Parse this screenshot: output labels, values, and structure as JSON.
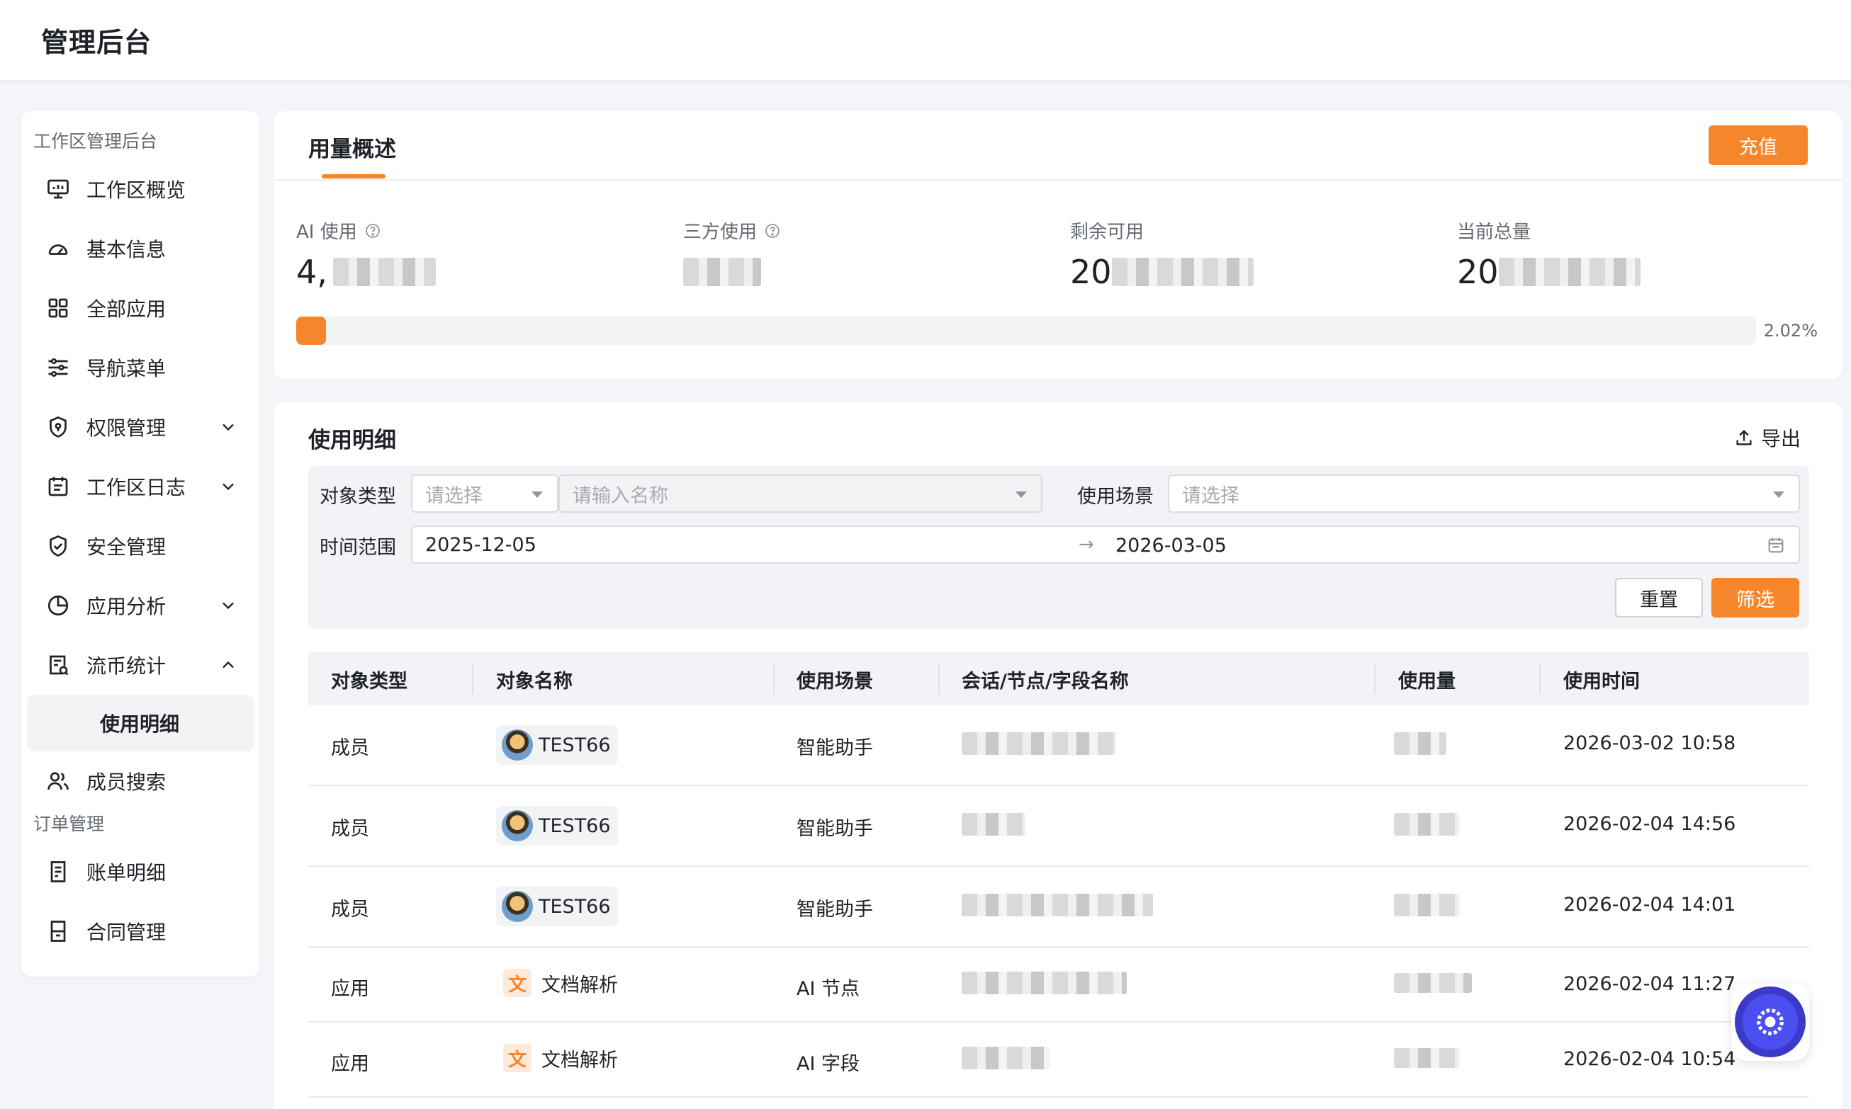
{
  "app": {
    "title": "管理后台"
  },
  "sidebar": {
    "group1": "工作区管理后台",
    "items": [
      {
        "label": "工作区概览",
        "icon": "monitor-icon"
      },
      {
        "label": "基本信息",
        "icon": "dashboard-icon"
      },
      {
        "label": "全部应用",
        "icon": "grid-icon"
      },
      {
        "label": "导航菜单",
        "icon": "sliders-icon"
      },
      {
        "label": "权限管理",
        "icon": "shield-lock-icon",
        "expandable": true
      },
      {
        "label": "工作区日志",
        "icon": "calendar-icon",
        "expandable": true
      },
      {
        "label": "安全管理",
        "icon": "shield-check-icon"
      },
      {
        "label": "应用分析",
        "icon": "pie-chart-icon",
        "expandable": true
      },
      {
        "label": "流币统计",
        "icon": "report-icon",
        "expanded": true
      }
    ],
    "sub_item": "使用明细",
    "item_member_search": "成员搜索",
    "group2": "订单管理",
    "items2": [
      {
        "label": "账单明细",
        "icon": "bill-icon"
      },
      {
        "label": "合同管理",
        "icon": "contract-icon"
      }
    ]
  },
  "overview": {
    "tab": "用量概述",
    "recharge": "充值",
    "stats": [
      {
        "label": "AI 使用",
        "value_prefix": "4,"
      },
      {
        "label": "三方使用",
        "value_prefix": ""
      },
      {
        "label": "剩余可用",
        "value_prefix": "20"
      },
      {
        "label": "当前总量",
        "value_prefix": "20"
      }
    ],
    "progress_percent": 2.02,
    "progress_text": "2.02%"
  },
  "detail": {
    "title": "使用明细",
    "export": "导出",
    "filters": {
      "object_type_label": "对象类型",
      "object_type_placeholder": "请选择",
      "name_placeholder": "请输入名称",
      "scene_label": "使用场景",
      "scene_placeholder": "请选择",
      "time_label": "时间范围",
      "start_date": "2025-12-05",
      "arrow": "→",
      "end_date": "2026-03-05",
      "reset": "重置",
      "filter": "筛选"
    },
    "columns": [
      "对象类型",
      "对象名称",
      "使用场景",
      "会话/节点/字段名称",
      "使用量",
      "使用时间"
    ],
    "rows": [
      {
        "type": "成员",
        "name": "TEST66",
        "kind": "member",
        "scene": "智能助手",
        "time": "2026-03-02 10:58"
      },
      {
        "type": "成员",
        "name": "TEST66",
        "kind": "member",
        "scene": "智能助手",
        "time": "2026-02-04 14:56"
      },
      {
        "type": "成员",
        "name": "TEST66",
        "kind": "member",
        "scene": "智能助手",
        "time": "2026-02-04 14:01"
      },
      {
        "type": "应用",
        "name": "文档解析",
        "kind": "app",
        "scene": "AI 节点",
        "time": "2026-02-04 11:27"
      },
      {
        "type": "应用",
        "name": "文档解析",
        "kind": "app",
        "scene": "AI 字段",
        "time": "2026-02-04 10:54"
      }
    ],
    "doc_glyph": "文"
  },
  "colors": {
    "accent": "#f5862b",
    "bg": "#f4f5f8"
  }
}
